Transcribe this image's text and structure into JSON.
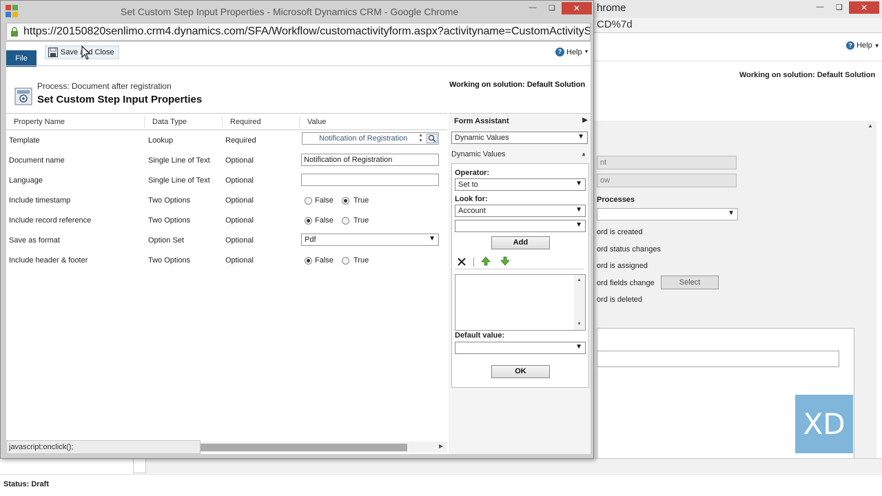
{
  "background_window": {
    "title": "hrome",
    "url_fragment": "CD%7d",
    "help": "Help",
    "solution": "Working on solution: Default Solution",
    "field1": "nt",
    "field2": "ow",
    "processes_label": "Processes",
    "checks": [
      "ord is created",
      "ord status changes",
      "ord is assigned",
      "ord fields change",
      "ord is deleted"
    ],
    "select_button": "Select",
    "logo": "XD",
    "status": "Status: Draft"
  },
  "popup": {
    "title": "Set Custom Step Input Properties - Microsoft Dynamics CRM - Google Chrome",
    "url": "https://20150820senlimo.crm4.dynamics.com/SFA/Workflow/customactivityform.aspx?activityname=CustomActivityS",
    "ribbon": {
      "file": "File",
      "save_close": "Save and Close",
      "help": "Help"
    },
    "header": {
      "process": "Process: Document after registration",
      "title": "Set Custom Step Input Properties",
      "solution": "Working on solution: Default Solution"
    },
    "grid": {
      "columns": [
        "Property Name",
        "Data Type",
        "Required",
        "Value"
      ],
      "rows": [
        {
          "name": "Template",
          "type": "Lookup",
          "required": "Required",
          "value": "Notification of Registration"
        },
        {
          "name": "Document name",
          "type": "Single Line of Text",
          "required": "Optional",
          "value": "Notification of Registration"
        },
        {
          "name": "Language",
          "type": "Single Line of Text",
          "required": "Optional",
          "value": ""
        },
        {
          "name": "Include timestamp",
          "type": "Two Options",
          "required": "Optional",
          "value": "True"
        },
        {
          "name": "Include record reference",
          "type": "Two Options",
          "required": "Optional",
          "value": "False"
        },
        {
          "name": "Save as format",
          "type": "Option Set",
          "required": "Optional",
          "value": "Pdf"
        },
        {
          "name": "Include header & footer",
          "type": "Two Options",
          "required": "Optional",
          "value": "False"
        }
      ],
      "option_false": "False",
      "option_true": "True"
    },
    "form_assistant": {
      "title": "Form Assistant",
      "mode": "Dynamic Values",
      "section": "Dynamic Values",
      "operator_label": "Operator:",
      "operator_value": "Set to",
      "look_for_label": "Look for:",
      "look_for_value": "Account",
      "look_for_field": "",
      "add": "Add",
      "default_value_label": "Default value:",
      "default_value": "",
      "ok": "OK"
    },
    "status_bar": "javascript:onclick();"
  }
}
